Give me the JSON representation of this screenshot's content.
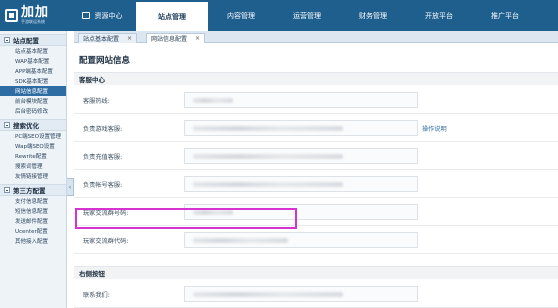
{
  "app": {
    "logo_title": "加加",
    "logo_subtitle": "手游联运系统"
  },
  "topnav": [
    {
      "label": "资源中心",
      "active": false
    },
    {
      "label": "站点管理",
      "active": true
    },
    {
      "label": "内容管理",
      "active": false
    },
    {
      "label": "运营管理",
      "active": false
    },
    {
      "label": "财务管理",
      "active": false
    },
    {
      "label": "开放平台",
      "active": false
    },
    {
      "label": "推广平台",
      "active": false
    }
  ],
  "sidebar": {
    "groups": [
      {
        "title": "站点配置",
        "items": [
          "站点基本配置",
          "WAP基本配置",
          "APP端基本配置",
          "SDK基本配置",
          "网站信息配置",
          "前台模块配置",
          "后台密码修改"
        ]
      },
      {
        "title": "搜索优化",
        "items": [
          "PC端SEO设置管理",
          "Wap端SEO设置",
          "Rewrite配置",
          "搜索词管理",
          "友情链接管理"
        ]
      },
      {
        "title": "第三方配置",
        "items": [
          "支付信息配置",
          "短信信息配置",
          "发送邮件配置",
          "Ucenter配置",
          "其他接入配置"
        ]
      }
    ],
    "active_item": "网站信息配置"
  },
  "tabs": [
    {
      "label": "站点基本配置",
      "close": "×"
    },
    {
      "label": "网站信息配置",
      "close": "×"
    }
  ],
  "main": {
    "page_title": "配置网站信息",
    "sections": [
      {
        "title": "客服中心"
      },
      {
        "title": "右侧按钮"
      }
    ],
    "fields": [
      {
        "label": "客服热线:"
      },
      {
        "label": "负责游戏客服:",
        "link": "操作说明"
      },
      {
        "label": "负责充值客服:"
      },
      {
        "label": "负责帐号客服:"
      },
      {
        "label": "玩家交流群号码:"
      },
      {
        "label": "玩家交流群代码:"
      },
      {
        "label": "联系我们:"
      }
    ]
  },
  "colors": {
    "topbar": "#1f5f8e",
    "highlight": "#d633d0",
    "active_sidebar": "#2e6da4"
  }
}
